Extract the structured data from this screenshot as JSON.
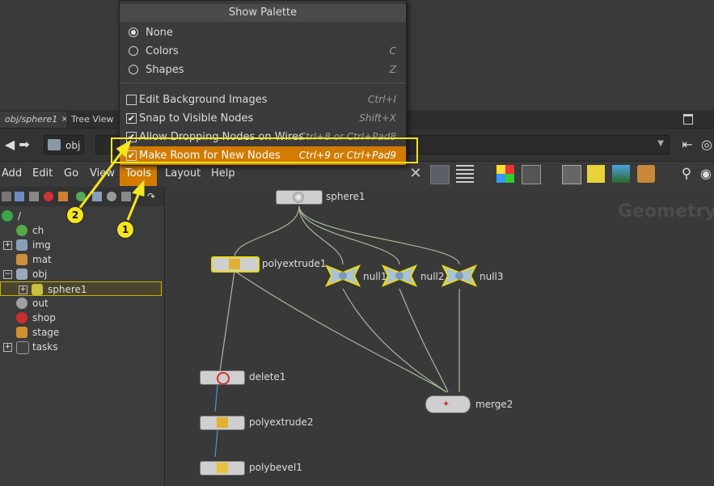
{
  "tabs": {
    "path_tab": "obj/sphere1",
    "close": "×",
    "tree_tab": "Tree View"
  },
  "path": {
    "crumb": "obj"
  },
  "menubar": [
    "Add",
    "Edit",
    "Go",
    "View",
    "Tools",
    "Layout",
    "Help"
  ],
  "dropdown": {
    "header": "Show Palette",
    "radios": [
      {
        "label": "None",
        "shortcut": "",
        "checked": true
      },
      {
        "label": "Colors",
        "shortcut": "C",
        "checked": false
      },
      {
        "label": "Shapes",
        "shortcut": "Z",
        "checked": false
      }
    ],
    "checks": [
      {
        "label": "Edit Background Images",
        "shortcut": "Ctrl+I",
        "checked": false
      },
      {
        "label": "Snap to Visible Nodes",
        "shortcut": "Shift+X",
        "checked": true
      },
      {
        "label": "Allow Dropping Nodes on Wires",
        "shortcut": "Ctrl+8 or Ctrl+Pad8",
        "checked": true
      },
      {
        "label": "Make Room for New Nodes",
        "shortcut": "Ctrl+9 or Ctrl+Pad9",
        "checked": true
      }
    ]
  },
  "tree": [
    {
      "label": "/",
      "icon": "globe-icon",
      "color": "#3aa64a",
      "expand": ""
    },
    {
      "label": "ch",
      "icon": "channel-icon",
      "color": "#5aa84a",
      "expand": ""
    },
    {
      "label": "img",
      "icon": "image-icon",
      "color": "#8aa0b8",
      "expand": "+"
    },
    {
      "label": "mat",
      "icon": "material-icon",
      "color": "#c89040",
      "expand": ""
    },
    {
      "label": "obj",
      "icon": "object-icon",
      "color": "#9aa8b8",
      "expand": "−"
    },
    {
      "label": "sphere1",
      "icon": "geometry-icon",
      "color": "#c8c040",
      "expand": "+"
    },
    {
      "label": "out",
      "icon": "output-icon",
      "color": "#a0a0a0",
      "expand": ""
    },
    {
      "label": "shop",
      "icon": "shop-icon",
      "color": "#c83030",
      "expand": ""
    },
    {
      "label": "stage",
      "icon": "stage-icon",
      "color": "#d09030",
      "expand": ""
    },
    {
      "label": "tasks",
      "icon": "tasks-icon",
      "color": "#404040",
      "expand": "+"
    }
  ],
  "network": {
    "context_label": "Geometry",
    "nodes": {
      "sphere1": "sphere1",
      "polyextrude1": "polyextrude1",
      "null1": "null1",
      "null2": "null2",
      "null3": "null3",
      "delete1": "delete1",
      "polyextrude2": "polyextrude2",
      "polybevel1": "polybevel1",
      "merge2": "merge2"
    }
  },
  "annotations": {
    "badge1": "1",
    "badge2": "2"
  },
  "colors": {
    "accent": "#d27b00",
    "highlight": "#f5e51c"
  }
}
